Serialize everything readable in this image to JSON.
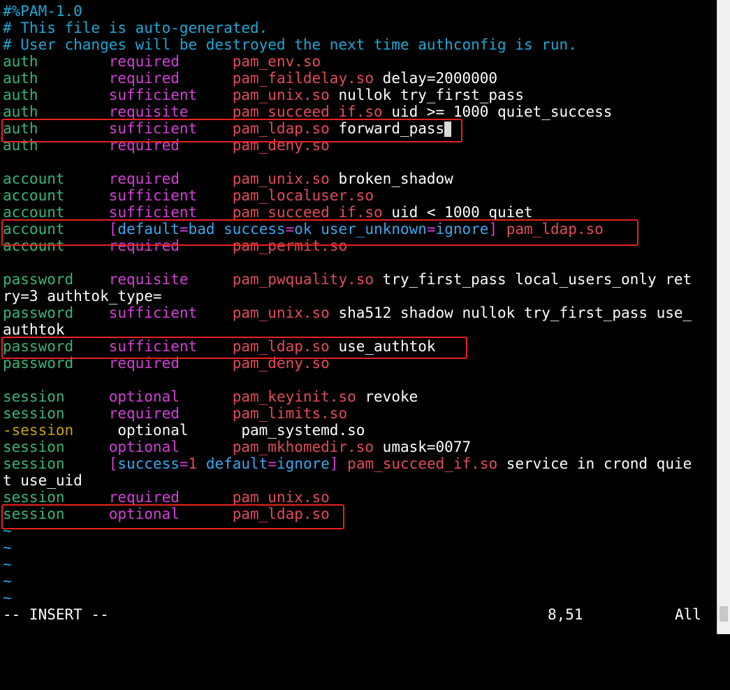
{
  "lines": [
    [
      {
        "t": "#%PAM-1.0",
        "c": "c-comment"
      }
    ],
    [
      {
        "t": "# This file is auto-generated.",
        "c": "c-comment"
      }
    ],
    [
      {
        "t": "# User changes will be destroyed the next time authconfig is run.",
        "c": "c-comment"
      }
    ],
    [
      {
        "t": "auth        ",
        "c": "c-green"
      },
      {
        "t": "required      ",
        "c": "c-magenta"
      },
      {
        "t": "pam_env.so",
        "c": "c-red"
      }
    ],
    [
      {
        "t": "auth        ",
        "c": "c-green"
      },
      {
        "t": "required      ",
        "c": "c-magenta"
      },
      {
        "t": "pam_faildelay.so",
        "c": "c-red"
      },
      {
        "t": " delay=2000000",
        "c": "c-white"
      }
    ],
    [
      {
        "t": "auth        ",
        "c": "c-green"
      },
      {
        "t": "sufficient    ",
        "c": "c-magenta"
      },
      {
        "t": "pam_unix.so",
        "c": "c-red"
      },
      {
        "t": " nullok try_first_pass",
        "c": "c-white"
      }
    ],
    [
      {
        "t": "auth        ",
        "c": "c-green"
      },
      {
        "t": "requisite     ",
        "c": "c-magenta"
      },
      {
        "t": "pam_succeed_if.so",
        "c": "c-red"
      },
      {
        "t": " uid >= 1000 quiet_success",
        "c": "c-white"
      }
    ],
    [
      {
        "t": "auth        ",
        "c": "c-green"
      },
      {
        "t": "sufficient    ",
        "c": "c-magenta"
      },
      {
        "t": "pam_ldap.so",
        "c": "c-red"
      },
      {
        "t": " forward_pass",
        "c": "c-white"
      },
      {
        "t": " ",
        "c": "cursor"
      }
    ],
    [
      {
        "t": "auth        ",
        "c": "c-green"
      },
      {
        "t": "required      ",
        "c": "c-magenta"
      },
      {
        "t": "pam_deny.so",
        "c": "c-red"
      }
    ],
    [],
    [
      {
        "t": "account     ",
        "c": "c-green"
      },
      {
        "t": "required      ",
        "c": "c-magenta"
      },
      {
        "t": "pam_unix.so",
        "c": "c-red"
      },
      {
        "t": " broken_shadow",
        "c": "c-white"
      }
    ],
    [
      {
        "t": "account     ",
        "c": "c-green"
      },
      {
        "t": "sufficient    ",
        "c": "c-magenta"
      },
      {
        "t": "pam_localuser.so",
        "c": "c-red"
      }
    ],
    [
      {
        "t": "account     ",
        "c": "c-green"
      },
      {
        "t": "sufficient    ",
        "c": "c-magenta"
      },
      {
        "t": "pam_succeed_if.so",
        "c": "c-red"
      },
      {
        "t": " uid < 1000 quiet",
        "c": "c-white"
      }
    ],
    [
      {
        "t": "account     ",
        "c": "c-green"
      },
      {
        "t": "[",
        "c": "c-magenta"
      },
      {
        "t": "default",
        "c": "c-blue"
      },
      {
        "t": "=",
        "c": "c-magenta"
      },
      {
        "t": "bad success",
        "c": "c-blue"
      },
      {
        "t": "=",
        "c": "c-magenta"
      },
      {
        "t": "ok user_unknown",
        "c": "c-blue"
      },
      {
        "t": "=",
        "c": "c-magenta"
      },
      {
        "t": "ignore",
        "c": "c-blue"
      },
      {
        "t": "] ",
        "c": "c-magenta"
      },
      {
        "t": "pam_ldap.so",
        "c": "c-red"
      }
    ],
    [
      {
        "t": "account     ",
        "c": "c-green"
      },
      {
        "t": "required      ",
        "c": "c-magenta"
      },
      {
        "t": "pam_permit.so",
        "c": "c-red"
      }
    ],
    [],
    [
      {
        "t": "password    ",
        "c": "c-green"
      },
      {
        "t": "requisite     ",
        "c": "c-magenta"
      },
      {
        "t": "pam_pwquality.so",
        "c": "c-red"
      },
      {
        "t": " try_first_pass local_users_only ret",
        "c": "c-white"
      }
    ],
    [
      {
        "t": "ry=3 authtok_type=",
        "c": "c-white"
      }
    ],
    [
      {
        "t": "password    ",
        "c": "c-green"
      },
      {
        "t": "sufficient    ",
        "c": "c-magenta"
      },
      {
        "t": "pam_unix.so",
        "c": "c-red"
      },
      {
        "t": " sha512 shadow nullok try_first_pass use_",
        "c": "c-white"
      }
    ],
    [
      {
        "t": "authtok",
        "c": "c-white"
      }
    ],
    [
      {
        "t": "password    ",
        "c": "c-green"
      },
      {
        "t": "sufficient    ",
        "c": "c-magenta"
      },
      {
        "t": "pam_ldap.so",
        "c": "c-red"
      },
      {
        "t": " use_authtok",
        "c": "c-white"
      }
    ],
    [
      {
        "t": "password    ",
        "c": "c-green"
      },
      {
        "t": "required      ",
        "c": "c-magenta"
      },
      {
        "t": "pam_deny.so",
        "c": "c-red"
      }
    ],
    [],
    [
      {
        "t": "session     ",
        "c": "c-green"
      },
      {
        "t": "optional      ",
        "c": "c-magenta"
      },
      {
        "t": "pam_keyinit.so",
        "c": "c-red"
      },
      {
        "t": " revoke",
        "c": "c-white"
      }
    ],
    [
      {
        "t": "session     ",
        "c": "c-green"
      },
      {
        "t": "required      ",
        "c": "c-magenta"
      },
      {
        "t": "pam_limits.so",
        "c": "c-red"
      }
    ],
    [
      {
        "t": "-session     ",
        "c": "c-yellow"
      },
      {
        "t": "optional      pam_systemd.so",
        "c": "c-white"
      }
    ],
    [
      {
        "t": "session     ",
        "c": "c-green"
      },
      {
        "t": "optional      ",
        "c": "c-magenta"
      },
      {
        "t": "pam_mkhomedir.so",
        "c": "c-red"
      },
      {
        "t": " umask=0077",
        "c": "c-white"
      }
    ],
    [
      {
        "t": "session     ",
        "c": "c-green"
      },
      {
        "t": "[",
        "c": "c-magenta"
      },
      {
        "t": "success",
        "c": "c-blue"
      },
      {
        "t": "=",
        "c": "c-magenta"
      },
      {
        "t": "1",
        "c": "c-red"
      },
      {
        "t": " default",
        "c": "c-blue"
      },
      {
        "t": "=",
        "c": "c-magenta"
      },
      {
        "t": "ignore",
        "c": "c-blue"
      },
      {
        "t": "] ",
        "c": "c-magenta"
      },
      {
        "t": "pam_succeed_if.so",
        "c": "c-red"
      },
      {
        "t": " service in crond quie",
        "c": "c-white"
      }
    ],
    [
      {
        "t": "t use_uid",
        "c": "c-white"
      }
    ],
    [
      {
        "t": "session     ",
        "c": "c-green"
      },
      {
        "t": "required      ",
        "c": "c-magenta"
      },
      {
        "t": "pam_unix.so",
        "c": "c-red"
      }
    ],
    [
      {
        "t": "session     ",
        "c": "c-green"
      },
      {
        "t": "optional      ",
        "c": "c-magenta"
      },
      {
        "t": "pam_ldap.so",
        "c": "c-red"
      }
    ],
    [
      {
        "t": "~",
        "c": "c-tilde"
      }
    ],
    [
      {
        "t": "~",
        "c": "c-tilde"
      }
    ],
    [
      {
        "t": "~",
        "c": "c-tilde"
      }
    ],
    [
      {
        "t": "~",
        "c": "c-tilde"
      }
    ],
    [
      {
        "t": "~",
        "c": "c-tilde"
      }
    ]
  ],
  "status": {
    "mode": "-- INSERT --",
    "position": "8,51",
    "scroll": "All"
  },
  "colors": {
    "background": "#000000",
    "highlight_box": "#e8221e"
  }
}
